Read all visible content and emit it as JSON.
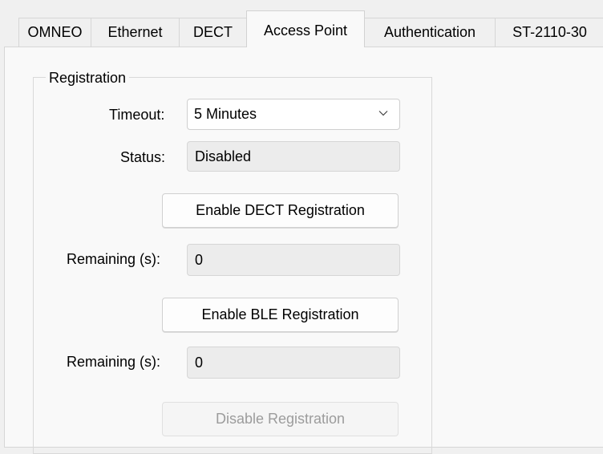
{
  "tabs": [
    {
      "label": "OMNEO",
      "active": false
    },
    {
      "label": "Ethernet",
      "active": false
    },
    {
      "label": "DECT",
      "active": false
    },
    {
      "label": "Access Point",
      "active": true
    },
    {
      "label": "Authentication",
      "active": false
    },
    {
      "label": "ST-2110-30",
      "active": false
    }
  ],
  "registration": {
    "group_title": "Registration",
    "timeout_label": "Timeout:",
    "timeout_value": "5 Minutes",
    "status_label": "Status:",
    "status_value": "Disabled",
    "enable_dect_button": "Enable DECT Registration",
    "dect_remaining_label": "Remaining (s):",
    "dect_remaining_value": "0",
    "enable_ble_button": "Enable BLE Registration",
    "ble_remaining_label": "Remaining (s):",
    "ble_remaining_value": "0",
    "disable_button": "Disable Registration"
  },
  "icons": {
    "timeout_dropdown": "chevron-down-icon"
  },
  "colors": {
    "window_bg": "#f0f0f0",
    "panel_bg": "#f9f9f9",
    "readonly_bg": "#ececec",
    "disabled_text": "#9c9c9c"
  }
}
